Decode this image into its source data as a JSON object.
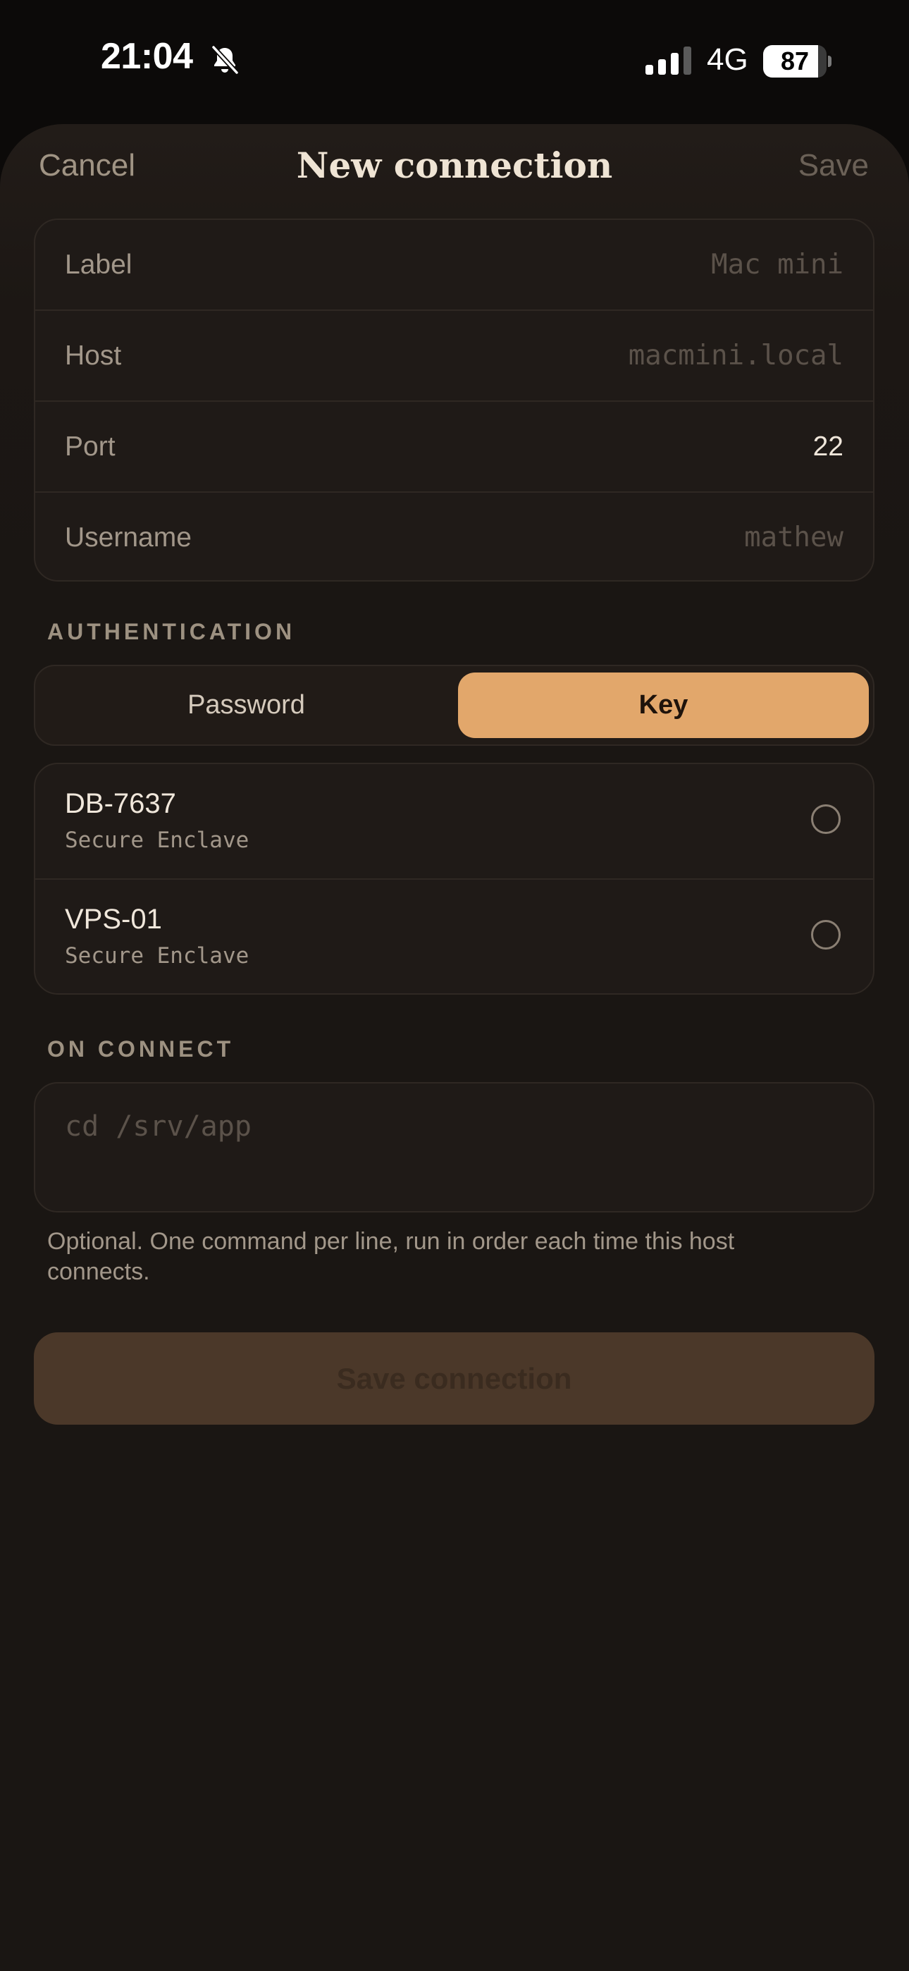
{
  "status_bar": {
    "time": "21:04",
    "network": "4G",
    "battery_level": "87",
    "battery_fraction": 0.87,
    "icons": [
      "bell-slash-icon",
      "signal-icon",
      "battery-icon"
    ]
  },
  "nav": {
    "cancel_label": "Cancel",
    "title": "New connection",
    "save_label": "Save"
  },
  "form": {
    "fields": [
      {
        "label": "Label",
        "value": "Mac mini",
        "is_placeholder": true
      },
      {
        "label": "Host",
        "value": "macmini.local",
        "is_placeholder": true
      },
      {
        "label": "Port",
        "value": "22",
        "is_placeholder": false
      },
      {
        "label": "Username",
        "value": "mathew",
        "is_placeholder": true
      }
    ]
  },
  "authentication": {
    "header": "AUTHENTICATION",
    "options": [
      "Password",
      "Key"
    ],
    "selected": "Key",
    "keys": [
      {
        "name": "DB-7637",
        "location": "Secure Enclave",
        "selected": false
      },
      {
        "name": "VPS-01",
        "location": "Secure Enclave",
        "selected": false
      }
    ]
  },
  "on_connect": {
    "header": "ON CONNECT",
    "placeholder": "cd /srv/app",
    "helper": "Optional. One command per line, run in order each time this host connects."
  },
  "primary_button": {
    "label": "Save connection",
    "enabled": false
  },
  "colors": {
    "accent": "#e2a76b",
    "background": "#1a1613",
    "disabled_button": "#4b3829"
  }
}
